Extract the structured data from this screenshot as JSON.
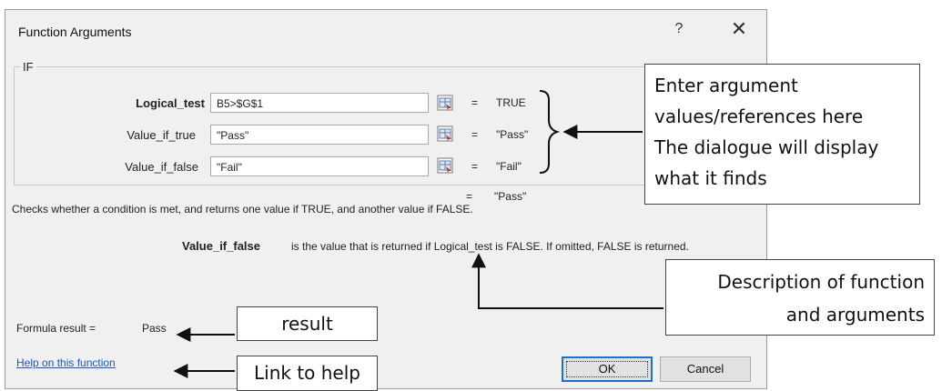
{
  "dialog": {
    "title": "Function Arguments",
    "help_button": "?",
    "close_button": "✕"
  },
  "function_name": "IF",
  "arguments": [
    {
      "label": "Logical_test",
      "value": "B5>$G$1",
      "result": "TRUE",
      "bold": true
    },
    {
      "label": "Value_if_true",
      "value": "\"Pass\"",
      "result": "\"Pass\"",
      "bold": false
    },
    {
      "label": "Value_if_false",
      "value": "\"Fail\"",
      "result": "\"Fail\"",
      "bold": false
    }
  ],
  "equals": "=",
  "overall_result": "\"Pass\"",
  "function_description": "Checks whether a condition is met, and returns one value if TRUE, and another value if FALSE.",
  "arg_description": {
    "name": "Value_if_false",
    "text": "is the value that is returned if Logical_test is FALSE. If omitted, FALSE is returned."
  },
  "formula_result": {
    "label": "Formula result =",
    "value": "Pass"
  },
  "help_link": "Help on this function",
  "buttons": {
    "ok": "OK",
    "cancel": "Cancel"
  },
  "callouts": {
    "arguments_lines": [
      "Enter argument",
      "values/references here",
      "The dialogue will display",
      "what it finds"
    ],
    "description_lines": [
      "Description of function",
      "and arguments"
    ],
    "result": "result",
    "link": "Link to help"
  },
  "colors": {
    "link": "#1a56c9",
    "ok_border": "#1f6fd0",
    "dialog_bg": "#f0f0f0"
  }
}
